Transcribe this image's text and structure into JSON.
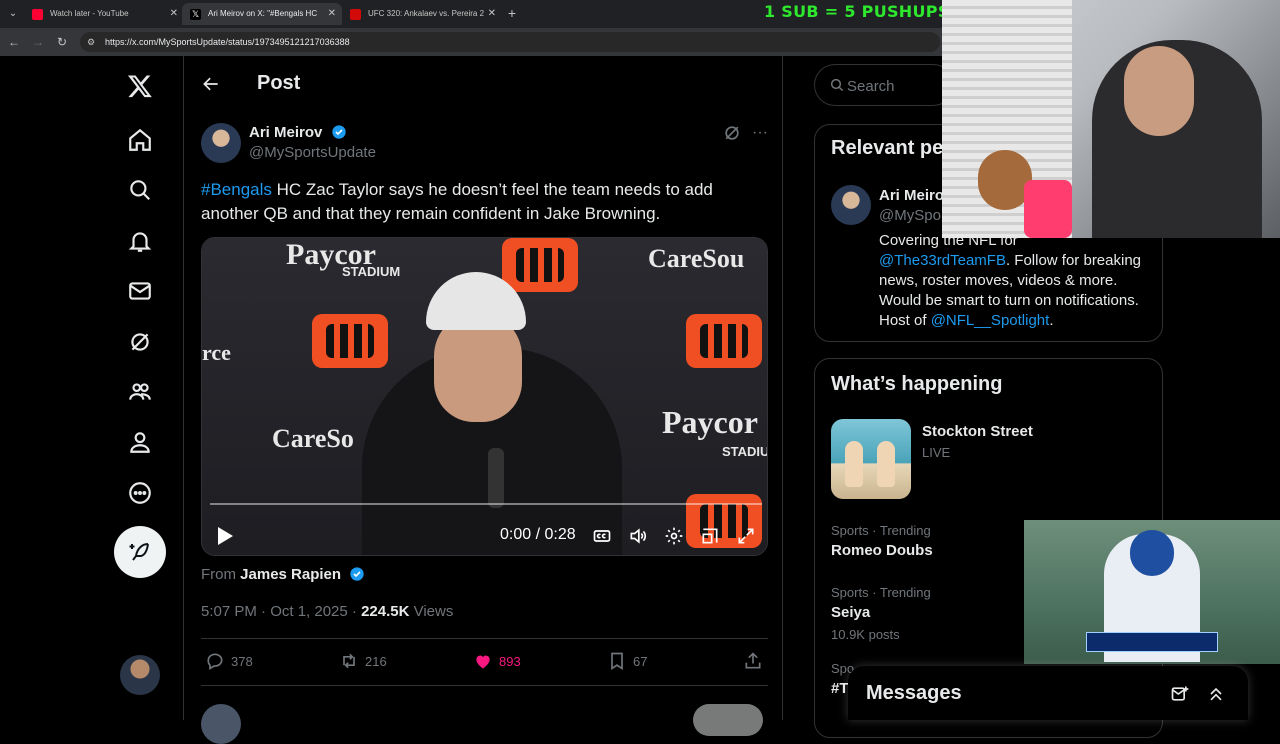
{
  "browser": {
    "tabs": [
      {
        "title": "Watch later - YouTube",
        "favicon_color": "#ff0033"
      },
      {
        "title": "Ari Meirov on X: \"#Bengals HC",
        "favicon_color": "#000000"
      },
      {
        "title": "UFC 320: Ankalaev vs. Pereira 2",
        "favicon_color": "#d20a0a"
      }
    ],
    "url": "https://x.com/MySportsUpdate/status/1973495121217036388"
  },
  "stream_overlay": {
    "text": "1 SUB = 5 PUSHUPS"
  },
  "main": {
    "header_title": "Post",
    "author": {
      "name": "Ari Meirov",
      "handle": "@MySportsUpdate"
    },
    "tweet": {
      "hashtag": "#Bengals",
      "text": " HC Zac Taylor says he doesn’t feel the team needs to add another QB and that they remain confident in Jake Browning."
    },
    "video": {
      "time": "0:00 / 0:28",
      "logo_words": [
        "Paycor",
        "STADIUM",
        "CareSou",
        "rce",
        "CareSo",
        "Paycor",
        "STADIU"
      ]
    },
    "from": {
      "label": "From",
      "name": "James Rapien"
    },
    "meta": {
      "time": "5:07 PM · Oct 1, 2025 · ",
      "views": "224.5K",
      "views_label": " Views"
    },
    "actions": {
      "replies": "378",
      "reposts": "216",
      "likes": "893",
      "bookmarks": "67"
    }
  },
  "right": {
    "search_placeholder": "Search",
    "relevant": {
      "title": "Relevant pe",
      "name": "Ari Meiro",
      "handle": "@MySpo",
      "bio_line1": "Covering the NFL for",
      "bio_link1": "@The33rdTeamFB",
      "bio_mid": ". Follow for breaking news, roster moves, videos & more. Would be smart to turn on notifications. Host of ",
      "bio_link2": "@NFL__Spotlight",
      "bio_end": "."
    },
    "happening": {
      "title": "What’s happening",
      "items": [
        {
          "title": "Stockton Street",
          "sub": "LIVE"
        },
        {
          "category": "Sports · Trending",
          "title": "Romeo Doubs"
        },
        {
          "category": "Sports · Trending",
          "title": "Seiya",
          "sub": "10.9K posts"
        },
        {
          "category": "Spo",
          "title": "#T"
        }
      ]
    }
  },
  "messages": {
    "title": "Messages"
  },
  "colors": {
    "accent": "#1d9bf0",
    "like": "#f91880",
    "overlay_text": "#2ee82e"
  }
}
